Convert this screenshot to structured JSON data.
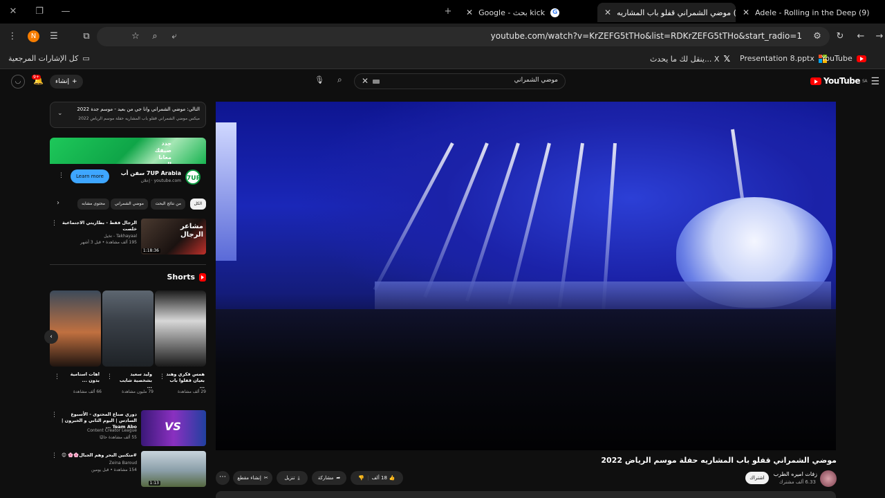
{
  "browser": {
    "tabs": [
      {
        "title": "Adele - Rolling in the Deep (9)",
        "active": false
      },
      {
        "title": "(9) موضي الشمراني قفلو باب المشاريه",
        "active": true
      },
      {
        "title": "kick بحث - Google",
        "active": false
      }
    ],
    "new_tab": "+",
    "url": "youtube.com/watch?v=KrZEFG5tTHo&list=RDKrZEFG5tTHo&start_radio=1",
    "profile_initial": "N",
    "bookmarks": [
      {
        "label": "YouTube",
        "icon": "youtube-icon"
      },
      {
        "label": "Presentation 8.pptx",
        "icon": "microsoft-icon"
      },
      {
        "label": "ينقل لك ما يحدث... X",
        "icon": "x-icon"
      },
      {
        "label": "كل الإشارات المرجعية",
        "icon": "folder-icon"
      }
    ]
  },
  "yt": {
    "logo": "YouTube",
    "region": "SA",
    "search_query": "موضي الشمراني",
    "create_label": "إنشاء",
    "notifications": "9+"
  },
  "video": {
    "title": "موضي الشمراني قفلو باب المشاريه حفلة موسم الرياض 2022",
    "channel": "زفات اميره الطرب",
    "subscribers": "6.33 ألف مشترك",
    "subscribe_label": "اشتراك",
    "likes": "18 ألف",
    "share_label": "مشاركة",
    "download_label": "تنزيل",
    "clip_label": "إنشاء مقطع"
  },
  "playlist": {
    "title": "التالي: موضي الشمراني وانا جي من بعيد - موسم جدة 2022",
    "subtitle": "ميكس موضي الشمراني قفلو باب المشاريه حفلة موسم الرياض 2022"
  },
  "ad": {
    "banner_text": "جدد\nصيفك\nمعانا\nالحين",
    "name": "7UP Arabia سفن أب",
    "site": "youtube.com · إعلان",
    "button": "Learn more",
    "logo": "7UP"
  },
  "chips": [
    {
      "label": "الكل",
      "active": true
    },
    {
      "label": "من نتائج البحث",
      "active": false
    },
    {
      "label": "موضي الشمراني",
      "active": false
    },
    {
      "label": "محتوى مشابه",
      "active": false
    }
  ],
  "recos": [
    {
      "title": "الرجال فقط - بطاريتي الاجتماعية خلصت",
      "channel": "Takhayaal - تخيل",
      "meta": "195 ألف مشاهدة • قبل 3 أشهر",
      "duration": "1:18:36",
      "thumb_text": "مشاعر الرجال"
    },
    {
      "title": "دوري صناع المحتوى - الأسبوع السادس | اليوم الثاني و الخبرون | Team Abo ...",
      "channel": "Content Creator League",
      "meta": "55 ألف مشاهدة حاليًا",
      "duration": "",
      "thumb_text": "VS"
    },
    {
      "title": "#متكنين البحر وهم الجبال🌸🌸 😊",
      "channel": "Zeina Baroud",
      "meta": "154 مشاهدة • قبل يومين",
      "duration": "1:13",
      "thumb_text": ""
    }
  ],
  "shorts": {
    "heading": "Shorts",
    "items": [
      {
        "title": "همس فكري وهند بعيان قفلوا باب ...",
        "views": "29 ألف مشاهدة"
      },
      {
        "title": "وليد سعيد بشخصية شايب ...",
        "views": "79 مليون مشاهدة"
      },
      {
        "title": "اهات استامية بدون ...",
        "views": "66 ألف مشاهدة"
      }
    ]
  },
  "colors": {
    "accent": "#ff0000",
    "learn_more": "#3ea6ff",
    "background": "#0f0f0f"
  }
}
